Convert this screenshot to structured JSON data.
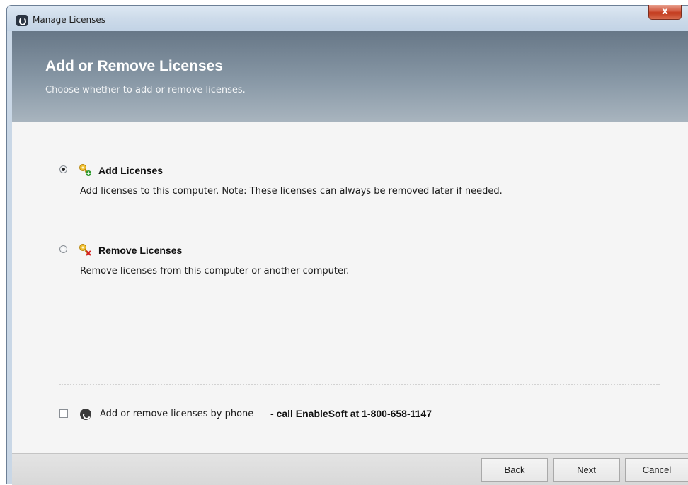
{
  "window": {
    "title": "Manage Licenses",
    "close_glyph": "x"
  },
  "header": {
    "title": "Add or Remove Licenses",
    "subtitle": "Choose whether to add or remove licenses."
  },
  "options": [
    {
      "label": "Add Licenses",
      "description": "Add licenses to this computer.  Note: These licenses can always be removed later if needed.",
      "selected": true,
      "icon": "key-add-icon"
    },
    {
      "label": "Remove Licenses",
      "description": "Remove licenses from this computer or another computer.",
      "selected": false,
      "icon": "key-remove-icon"
    }
  ],
  "phone": {
    "checked": false,
    "label": "Add or remove licenses by phone",
    "call_text": "- call EnableSoft at 1-800-658-1147",
    "icon": "phone-icon"
  },
  "buttons": {
    "back": "Back",
    "next": "Next",
    "cancel": "Cancel"
  },
  "colors": {
    "header_top": "#677787",
    "header_bottom": "#a8b4be",
    "close_button": "#c2391c"
  }
}
